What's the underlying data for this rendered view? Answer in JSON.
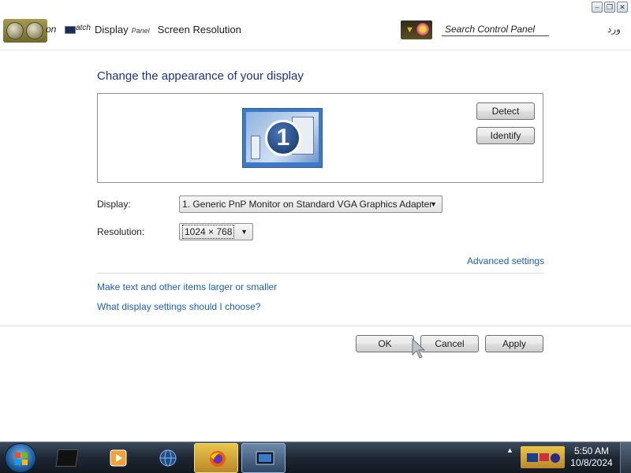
{
  "window": {
    "snip_left": "on",
    "snip_right": "atch",
    "breadcrumb": [
      "Display",
      "Panel"
    ],
    "current_page": "Screen Resolution",
    "search_placeholder": "Search Control Panel",
    "right_glyph": "ورد",
    "buttons": {
      "minimize": "–",
      "restore": "❐",
      "close": "✕"
    }
  },
  "content": {
    "heading": "Change the appearance of your display",
    "monitor_number": "1",
    "detect_label": "Detect",
    "identify_label": "Identify",
    "display_label": "Display:",
    "display_value": "1. Generic PnP Monitor on Standard VGA Graphics Adapter",
    "resolution_label": "Resolution:",
    "resolution_value": "1024 × 768",
    "advanced_link": "Advanced settings",
    "text_size_link": "Make text and other items larger or smaller",
    "which_settings_link": "What display settings should I choose?",
    "ok_label": "OK",
    "cancel_label": "Cancel",
    "apply_label": "Apply"
  },
  "taskbar": {
    "items": [
      "terminal-icon",
      "media-player-icon",
      "globe-icon",
      "firefox-icon",
      "display-settings-icon"
    ],
    "time": "5:50 AM",
    "date": "10/8/2024"
  },
  "colors": {
    "heading": "#1e3287",
    "link": "#1a5fb4",
    "taskbar": "#1d2733",
    "monitor": "#3d79c6"
  }
}
